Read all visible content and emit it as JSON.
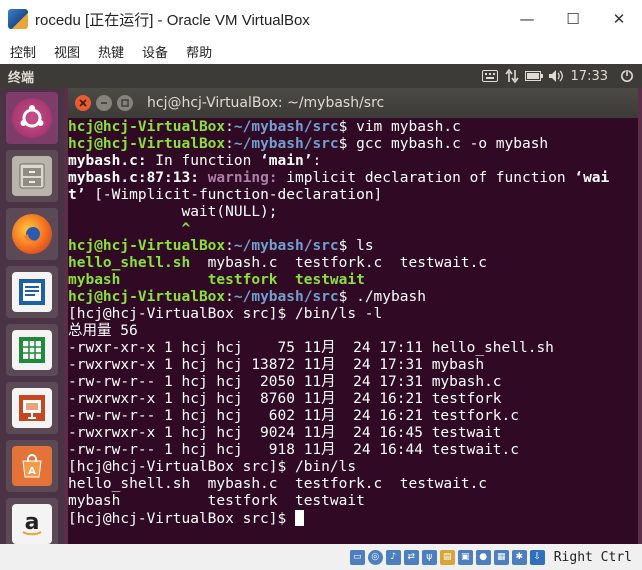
{
  "window": {
    "title": "rocedu [正在运行] - Oracle VM VirtualBox",
    "minimize": "—",
    "maximize": "☐",
    "close": "✕"
  },
  "menubar": {
    "items": [
      "控制",
      "视图",
      "热键",
      "设备",
      "帮助"
    ]
  },
  "panel": {
    "title": "终端",
    "time": "17:33"
  },
  "terminal": {
    "title": "hcj@hcj-VirtualBox: ~/mybash/src",
    "lines": [
      [
        {
          "t": "hcj@hcj-VirtualBox",
          "c": "pu"
        },
        {
          "t": ":",
          "c": ""
        },
        {
          "t": "~/mybash/src",
          "c": "pp"
        },
        {
          "t": "$ vim mybash.c",
          "c": ""
        }
      ],
      [
        {
          "t": "hcj@hcj-VirtualBox",
          "c": "pu"
        },
        {
          "t": ":",
          "c": ""
        },
        {
          "t": "~/mybash/src",
          "c": "pp"
        },
        {
          "t": "$ gcc mybash.c -o mybash",
          "c": ""
        }
      ],
      [
        {
          "t": "mybash.c:",
          "c": "b"
        },
        {
          "t": " In function ",
          "c": ""
        },
        {
          "t": "‘main’",
          "c": "b"
        },
        {
          "t": ":",
          "c": ""
        }
      ],
      [
        {
          "t": "mybash.c:87:13:",
          "c": "b"
        },
        {
          "t": " ",
          "c": ""
        },
        {
          "t": "warning:",
          "c": "warn"
        },
        {
          "t": " implicit declaration of function ",
          "c": ""
        },
        {
          "t": "‘wai",
          "c": "b"
        }
      ],
      [
        {
          "t": "t’",
          "c": "b"
        },
        {
          "t": " [-Wimplicit-function-declaration]",
          "c": ""
        }
      ],
      [
        {
          "t": "             wait(NULL);",
          "c": ""
        }
      ],
      [
        {
          "t": "             ^",
          "c": "grn"
        }
      ],
      [
        {
          "t": "hcj@hcj-VirtualBox",
          "c": "pu"
        },
        {
          "t": ":",
          "c": ""
        },
        {
          "t": "~/mybash/src",
          "c": "pp"
        },
        {
          "t": "$ ls",
          "c": ""
        }
      ],
      [
        {
          "t": "hello_shell.sh",
          "c": "grn"
        },
        {
          "t": "  mybash.c  testfork.c  testwait.c",
          "c": ""
        }
      ],
      [
        {
          "t": "mybash",
          "c": "grn"
        },
        {
          "t": "          ",
          "c": ""
        },
        {
          "t": "testfork",
          "c": "grn"
        },
        {
          "t": "  ",
          "c": ""
        },
        {
          "t": "testwait",
          "c": "grn"
        }
      ],
      [
        {
          "t": "hcj@hcj-VirtualBox",
          "c": "pu"
        },
        {
          "t": ":",
          "c": ""
        },
        {
          "t": "~/mybash/src",
          "c": "pp"
        },
        {
          "t": "$ ./mybash",
          "c": ""
        }
      ],
      [
        {
          "t": "[hcj@hcj-VirtualBox src]$ /bin/ls -l",
          "c": ""
        }
      ],
      [
        {
          "t": "总用量 56",
          "c": ""
        }
      ],
      [
        {
          "t": "-rwxr-xr-x 1 hcj hcj    75 11月  24 17:11 hello_shell.sh",
          "c": ""
        }
      ],
      [
        {
          "t": "-rwxrwxr-x 1 hcj hcj 13872 11月  24 17:31 mybash",
          "c": ""
        }
      ],
      [
        {
          "t": "-rw-rw-r-- 1 hcj hcj  2050 11月  24 17:31 mybash.c",
          "c": ""
        }
      ],
      [
        {
          "t": "-rwxrwxr-x 1 hcj hcj  8760 11月  24 16:21 testfork",
          "c": ""
        }
      ],
      [
        {
          "t": "-rw-rw-r-- 1 hcj hcj   602 11月  24 16:21 testfork.c",
          "c": ""
        }
      ],
      [
        {
          "t": "-rwxrwxr-x 1 hcj hcj  9024 11月  24 16:45 testwait",
          "c": ""
        }
      ],
      [
        {
          "t": "-rw-rw-r-- 1 hcj hcj   918 11月  24 16:44 testwait.c",
          "c": ""
        }
      ],
      [
        {
          "t": "[hcj@hcj-VirtualBox src]$ /bin/ls",
          "c": ""
        }
      ],
      [
        {
          "t": "hello_shell.sh  mybash.c  testfork.c  testwait.c",
          "c": ""
        }
      ],
      [
        {
          "t": "mybash          testfork  testwait",
          "c": ""
        }
      ],
      [
        {
          "t": "[hcj@hcj-VirtualBox src]$ ",
          "c": ""
        }
      ]
    ]
  },
  "statusbar": {
    "host_key": "Right Ctrl"
  },
  "colors": {
    "terminal_bg": "#300a24",
    "prompt_user": "#8ae234",
    "prompt_path": "#729fcf",
    "warning": "#ad7fa8"
  }
}
